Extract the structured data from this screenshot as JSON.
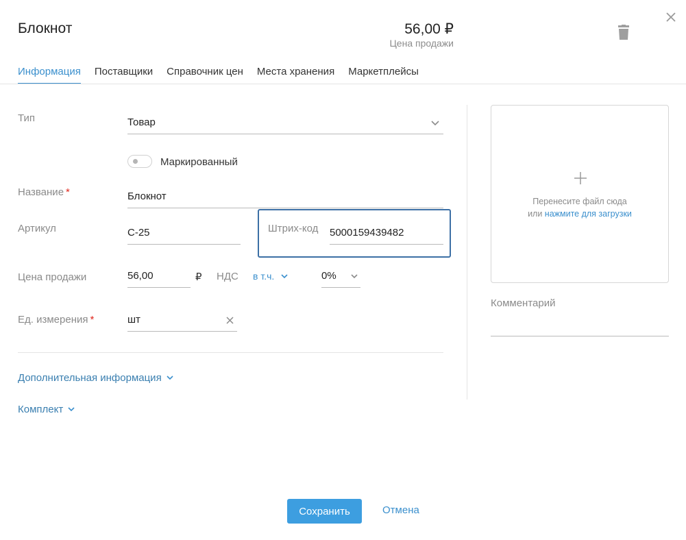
{
  "header": {
    "title": "Блокнот",
    "price": "56,00 ₽",
    "price_caption": "Цена продажи"
  },
  "tabs": [
    {
      "label": "Информация",
      "active": true
    },
    {
      "label": "Поставщики",
      "active": false
    },
    {
      "label": "Справочник цен",
      "active": false
    },
    {
      "label": "Места хранения",
      "active": false
    },
    {
      "label": "Маркетплейсы",
      "active": false
    }
  ],
  "form": {
    "type_label": "Тип",
    "type_value": "Товар",
    "marked_label": "Маркированный",
    "marked_on": false,
    "name_label": "Название",
    "name_value": "Блокнот",
    "required_mark": "*",
    "sku_label": "Артикул",
    "sku_value": "С-25",
    "barcode_label": "Штрих-код",
    "barcode_value": "5000159439482",
    "price_label": "Цена продажи",
    "price_value": "56,00",
    "currency": "₽",
    "vat_label": "НДС",
    "vat_mode": "в т.ч.",
    "vat_rate": "0%",
    "unit_label": "Ед. измерения",
    "unit_value": "шт"
  },
  "sections": {
    "additional_info": "Дополнительная информация",
    "kit": "Комплект"
  },
  "upload": {
    "line1": "Перенесите файл сюда",
    "line2_prefix": "или ",
    "line2_link": "нажмите для загрузки"
  },
  "comment": {
    "label": "Комментарий",
    "value": ""
  },
  "footer": {
    "save": "Сохранить",
    "cancel": "Отмена"
  },
  "colors": {
    "accent": "#3a8fcd",
    "primary_button": "#3d9ee0",
    "required": "#e0281e",
    "focus_border": "#3c6fa5"
  },
  "icons": [
    "trash-icon",
    "close-icon",
    "chevron-down-icon",
    "clear-icon",
    "plus-icon"
  ]
}
